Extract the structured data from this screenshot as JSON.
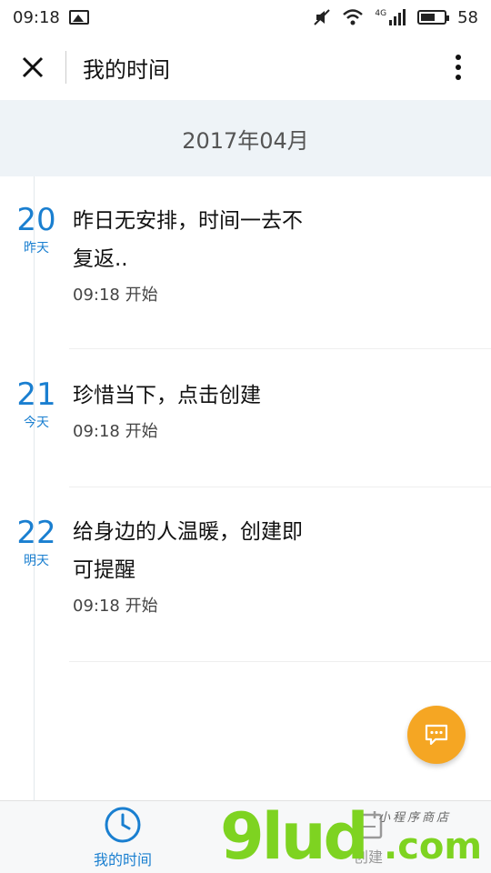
{
  "statusbar": {
    "time": "09:18",
    "battery": "58",
    "network": "4G"
  },
  "header": {
    "title": "我的时间"
  },
  "month": "2017年04月",
  "entries": [
    {
      "day": "20",
      "relative": "昨天",
      "line1": "昨日无安排，时间一去不",
      "line2": "复返..",
      "start": "09:18 开始"
    },
    {
      "day": "21",
      "relative": "今天",
      "line1": "珍惜当下，点击创建",
      "line2": "",
      "start": "09:18 开始"
    },
    {
      "day": "22",
      "relative": "明天",
      "line1": "给身边的人温暖，创建即",
      "line2": "可提醒",
      "start": "09:18 开始"
    }
  ],
  "tabs": [
    {
      "label": "我的时间",
      "icon": "clock-icon",
      "active": true
    },
    {
      "label": "创建",
      "icon": "calendar-icon",
      "active": false
    }
  ],
  "watermark": {
    "main": "9lud",
    "com": ".com",
    "small": "小程序商店"
  },
  "colors": {
    "accent": "#1a7fd0",
    "fab": "#f5a623",
    "banner": "#eef3f7",
    "watermark": "#7ed321"
  }
}
